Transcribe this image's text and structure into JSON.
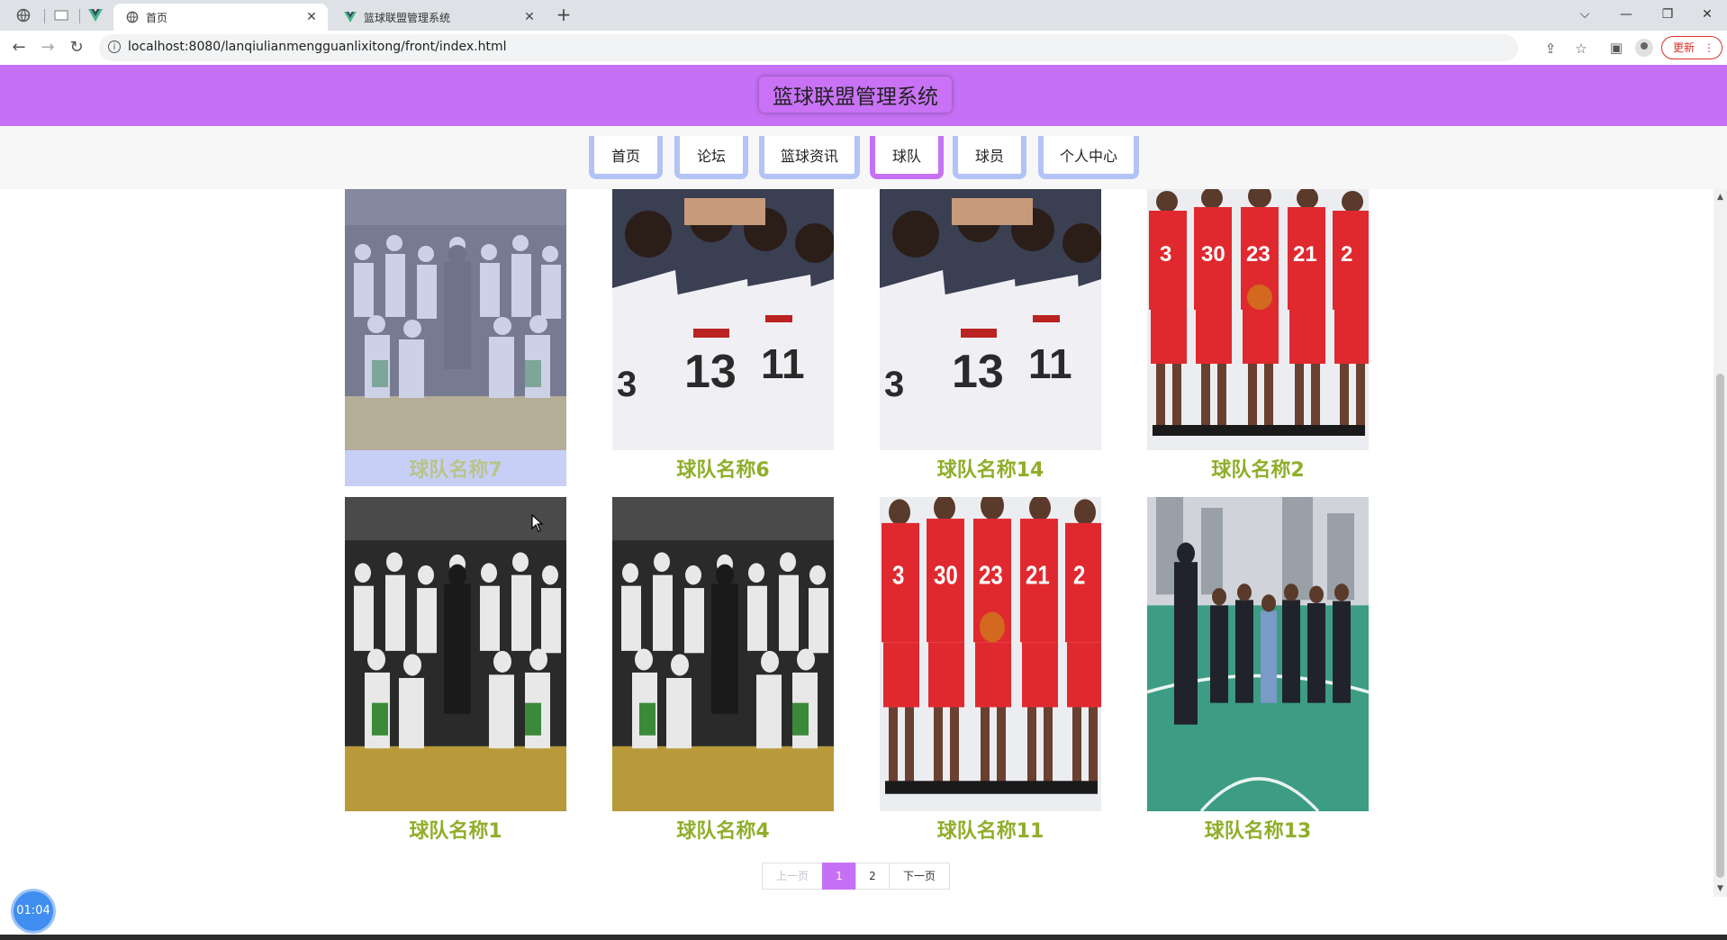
{
  "browser": {
    "tabs": [
      {
        "title": "首页",
        "active": true
      },
      {
        "title": "篮球联盟管理系统",
        "active": false
      }
    ],
    "url": "localhost:8080/lanqiulianmengguanlixitong/front/index.html",
    "update_label": "更新"
  },
  "site": {
    "title": "篮球联盟管理系统"
  },
  "nav": {
    "items": [
      {
        "label": "首页",
        "active": false
      },
      {
        "label": "论坛",
        "active": false
      },
      {
        "label": "篮球资讯",
        "active": false
      },
      {
        "label": "球队",
        "active": true
      },
      {
        "label": "球员",
        "active": false
      },
      {
        "label": "个人中心",
        "active": false
      }
    ]
  },
  "teams": [
    {
      "name": "球队名称7",
      "image": "celebration-photo",
      "hovered": true
    },
    {
      "name": "球队名称6",
      "image": "huddle-photo",
      "hovered": false
    },
    {
      "name": "球队名称14",
      "image": "huddle-photo",
      "hovered": false
    },
    {
      "name": "球队名称2",
      "image": "red-team-photo",
      "hovered": false
    },
    {
      "name": "球队名称1",
      "image": "celebration-photo",
      "hovered": false
    },
    {
      "name": "球队名称4",
      "image": "celebration-photo",
      "hovered": false
    },
    {
      "name": "球队名称11",
      "image": "red-team-photo",
      "hovered": false
    },
    {
      "name": "球队名称13",
      "image": "court-team-photo",
      "hovered": false
    }
  ],
  "pagination": {
    "prev_label": "上一页",
    "pages": [
      "1",
      "2"
    ],
    "current": "1",
    "next_label": "下一页"
  },
  "timer": {
    "text": "01:04"
  },
  "colors": {
    "header": "#c671f5",
    "nav_border": "#b3c3f6",
    "caption": "#8fae2a"
  }
}
